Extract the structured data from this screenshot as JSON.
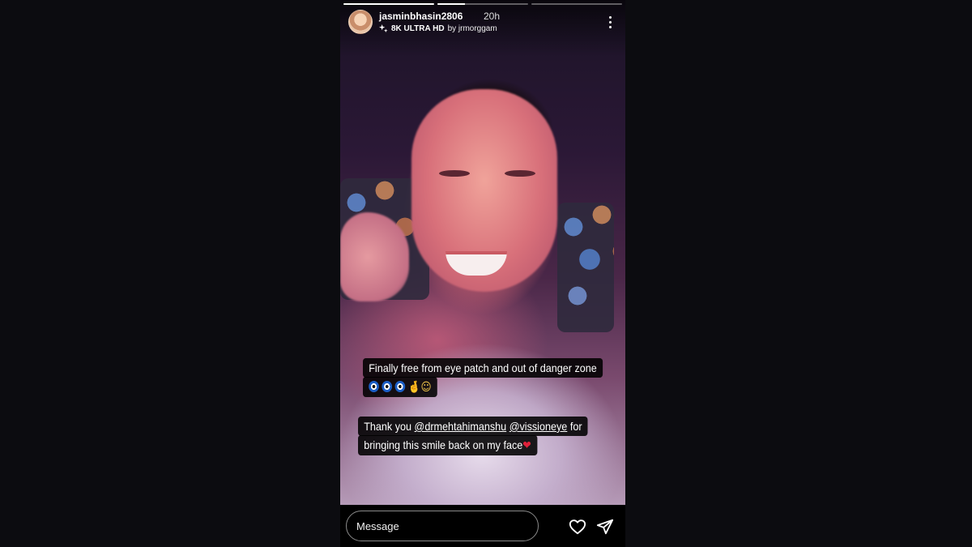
{
  "story": {
    "progress": [
      1,
      0.3,
      0
    ],
    "user": {
      "username": "jasminbhasin2806",
      "time": "20h",
      "music_title": "8K ULTRA HD",
      "music_by": "by jrmorggam"
    },
    "captions": {
      "line1": "Finally free from eye patch and out of danger zone",
      "line2_emoji_hand": "🤞",
      "line2_emoji_face": "☺",
      "thanks_prefix": "Thank you",
      "mention1": "@drmehtahimanshu",
      "mention2": "@vissioneye",
      "thanks_suffix": "for",
      "line4": "bringing this smile back on my face",
      "heart": "❤"
    },
    "icons": {
      "music": "sparkle-music-icon",
      "more": "more-vertical-icon",
      "like": "heart-icon",
      "send": "send-icon"
    }
  },
  "reply": {
    "placeholder": "Message"
  },
  "colors": {
    "background": "#0c0c10",
    "caption_bg": "#000000",
    "evil_eye_blue": "#1b5ec5",
    "heart_red": "#e0213a"
  }
}
